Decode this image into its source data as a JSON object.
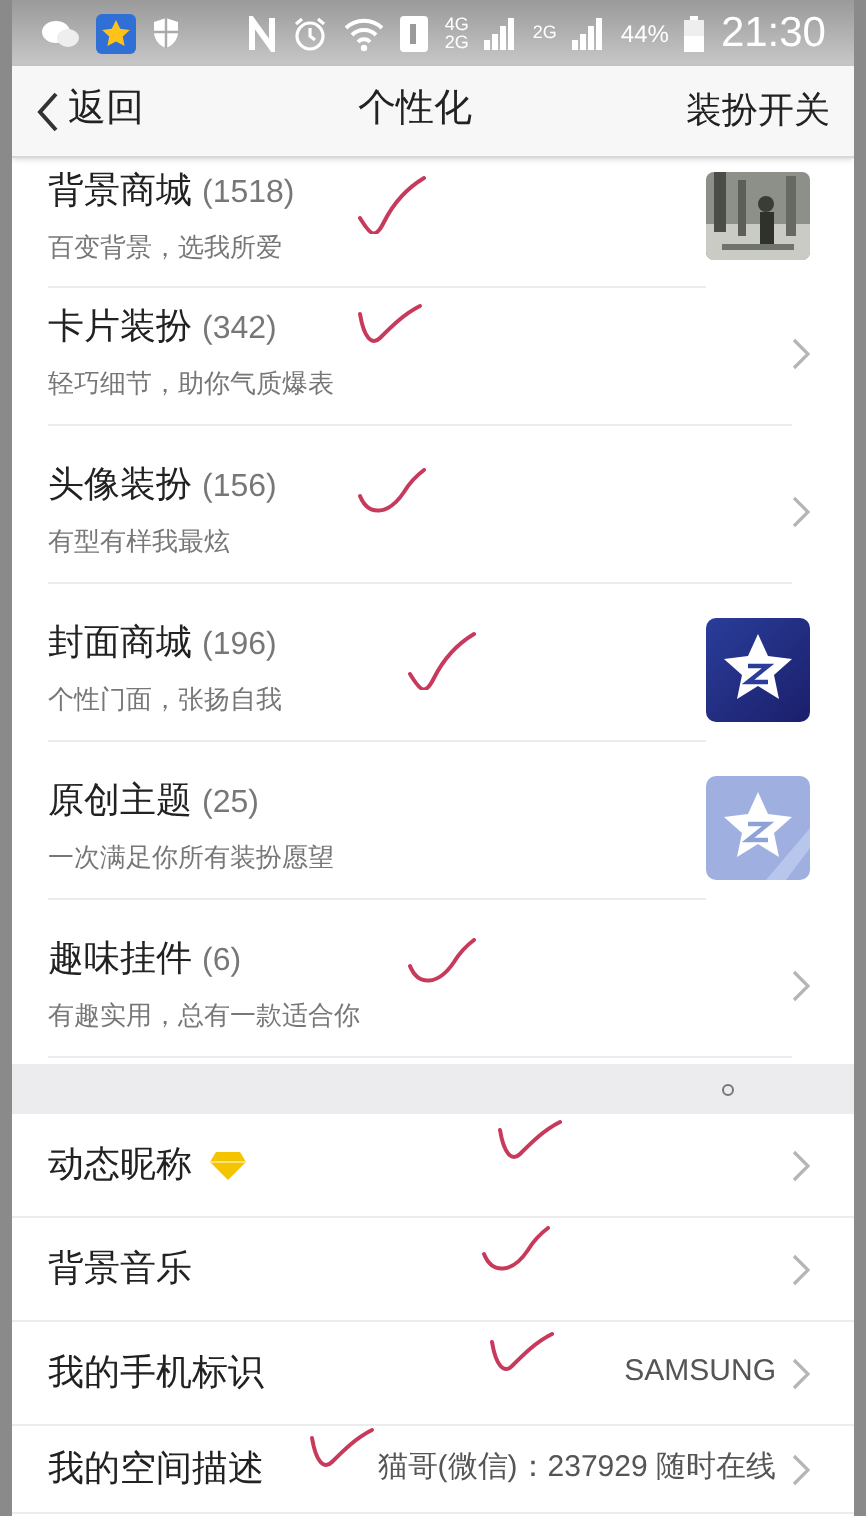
{
  "status_bar": {
    "network_labels": [
      "4G",
      "2G",
      "2G"
    ],
    "battery": "44%",
    "time": "21:30"
  },
  "nav": {
    "back": "返回",
    "title": "个性化",
    "action": "装扮开关"
  },
  "shop_items": [
    {
      "title": "背景商城",
      "count": "(1518)",
      "subtitle": "百变背景，选我所爱",
      "kind": "picture",
      "ticked": true
    },
    {
      "title": "卡片装扮",
      "count": "(342)",
      "subtitle": "轻巧细节，助你气质爆表",
      "kind": "chevron",
      "ticked": true
    },
    {
      "title": "头像装扮",
      "count": "(156)",
      "subtitle": "有型有样我最炫",
      "kind": "chevron",
      "ticked": true
    },
    {
      "title": "封面商城",
      "count": "(196)",
      "subtitle": "个性门面，张扬自我",
      "kind": "logo-dark",
      "ticked": true
    },
    {
      "title": "原创主题",
      "count": "(25)",
      "subtitle": "一次满足你所有装扮愿望",
      "kind": "logo-light",
      "ticked": false
    },
    {
      "title": "趣味挂件",
      "count": "(6)",
      "subtitle": "有趣实用，总有一款适合你",
      "kind": "chevron",
      "ticked": true
    }
  ],
  "settings": [
    {
      "label": "动态昵称",
      "vip": true,
      "ticked": true
    },
    {
      "label": "背景音乐",
      "vip": false,
      "ticked": true
    },
    {
      "label": "我的手机标识",
      "value": "SAMSUNG",
      "vip": false,
      "ticked": true
    },
    {
      "label": "我的空间描述",
      "value": "猫哥(微信)：237929 随时在线",
      "vip": false,
      "ticked": true
    }
  ]
}
